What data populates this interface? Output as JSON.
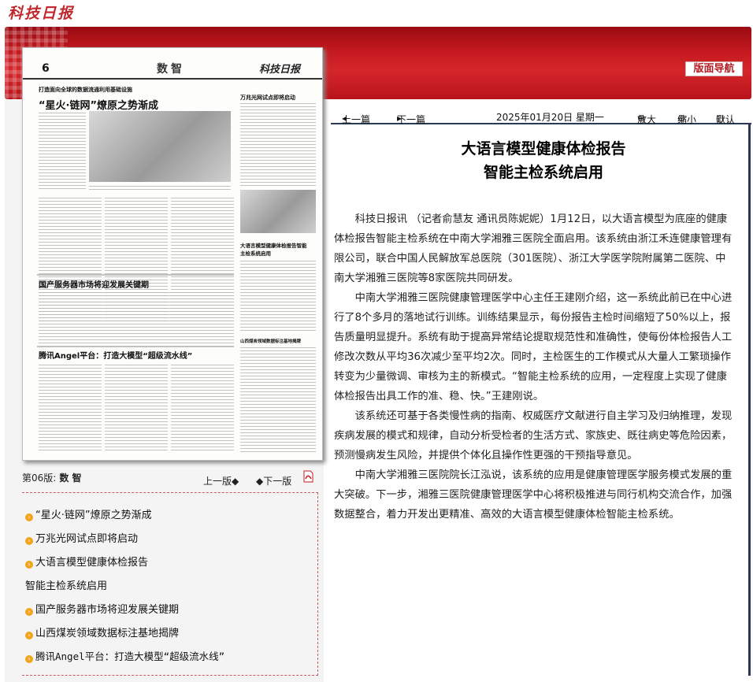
{
  "site": {
    "logo": "科技日报"
  },
  "banner": {
    "nav_button": "版面导航"
  },
  "newspaper_image": {
    "page_num": "6",
    "section": "数智",
    "masthead": "科技日报",
    "headlines": [
      "打造面向全球的数据流通利用基础设施",
      "“星火·链网”燎原之势渐成",
      "万兆光网试点即将启动",
      "国产服务器市场将迎发展关键期",
      "大语言模型健康体检报告智能主检系统启用",
      "腾讯Angel平台：打造大模型“超级流水线”",
      "山西煤炭领域数据标注基地揭牌"
    ]
  },
  "page_nav": {
    "page_label": "第06版:",
    "page_name": "数 智",
    "prev": "上一版",
    "next": "下一版",
    "pdf_icon": "pdf-icon"
  },
  "article_list": [
    "“星火·链网”燎原之势渐成",
    "万兆光网试点即将启动",
    "大语言模型健康体检报告",
    "智能主检系统启用",
    "国产服务器市场将迎发展关键期",
    "山西煤炭领域数据标注基地揭牌",
    "腾讯Angel平台：打造大模型“超级流水线”"
  ],
  "toolbar": {
    "prev_article": "上一篇",
    "next_article": "下一篇",
    "date": "2025年01月20日  星期一",
    "zoom_in": "放大",
    "zoom_out": "缩小",
    "default": "默认"
  },
  "article": {
    "title_line1": "大语言模型健康体检报告",
    "title_line2": "智能主检系统启用",
    "paragraphs": [
      "科技日报讯  （记者俞慧友  通讯员陈妮妮）1月12日，以大语言模型为底座的健康体检报告智能主检系统在中南大学湘雅三医院全面启用。该系统由浙江禾连健康管理有限公司，联合中国人民解放军总医院（301医院）、浙江大学医学院附属第二医院、中南大学湘雅三医院等8家医院共同研发。",
      "中南大学湘雅三医院健康管理医学中心主任王建刚介绍，这一系统此前已在中心进行了8个多月的落地试行训练。训练结果显示，每份报告主检时间缩短了50%以上，报告质量明显提升。系统有助于提高异常结论提取规范性和准确性，使每份体检报告人工修改次数从平均36次减少至平均2次。同时，主检医生的工作模式从大量人工繁琐操作转变为少量微调、审核为主的新模式。“智能主检系统的应用，一定程度上实现了健康体检报告出具工作的准、稳、快。”王建刚说。",
      "该系统还可基于各类慢性病的指南、权威医疗文献进行自主学习及归纳推理，发现疾病发展的模式和规律，自动分析受检者的生活方式、家族史、既往病史等危险因素，预测慢病发生风险，并提供个体化且操作性更强的干预指导意见。",
      "中南大学湘雅三医院院长江泓说，该系统的应用是健康管理医学服务模式发展的重大突破。下一步，湘雅三医院健康管理医学中心将积极推进与同行机构交流合作，加强数据整合，着力开发出更精准、高效的大语言模型健康体检智能主检系统。"
    ]
  }
}
